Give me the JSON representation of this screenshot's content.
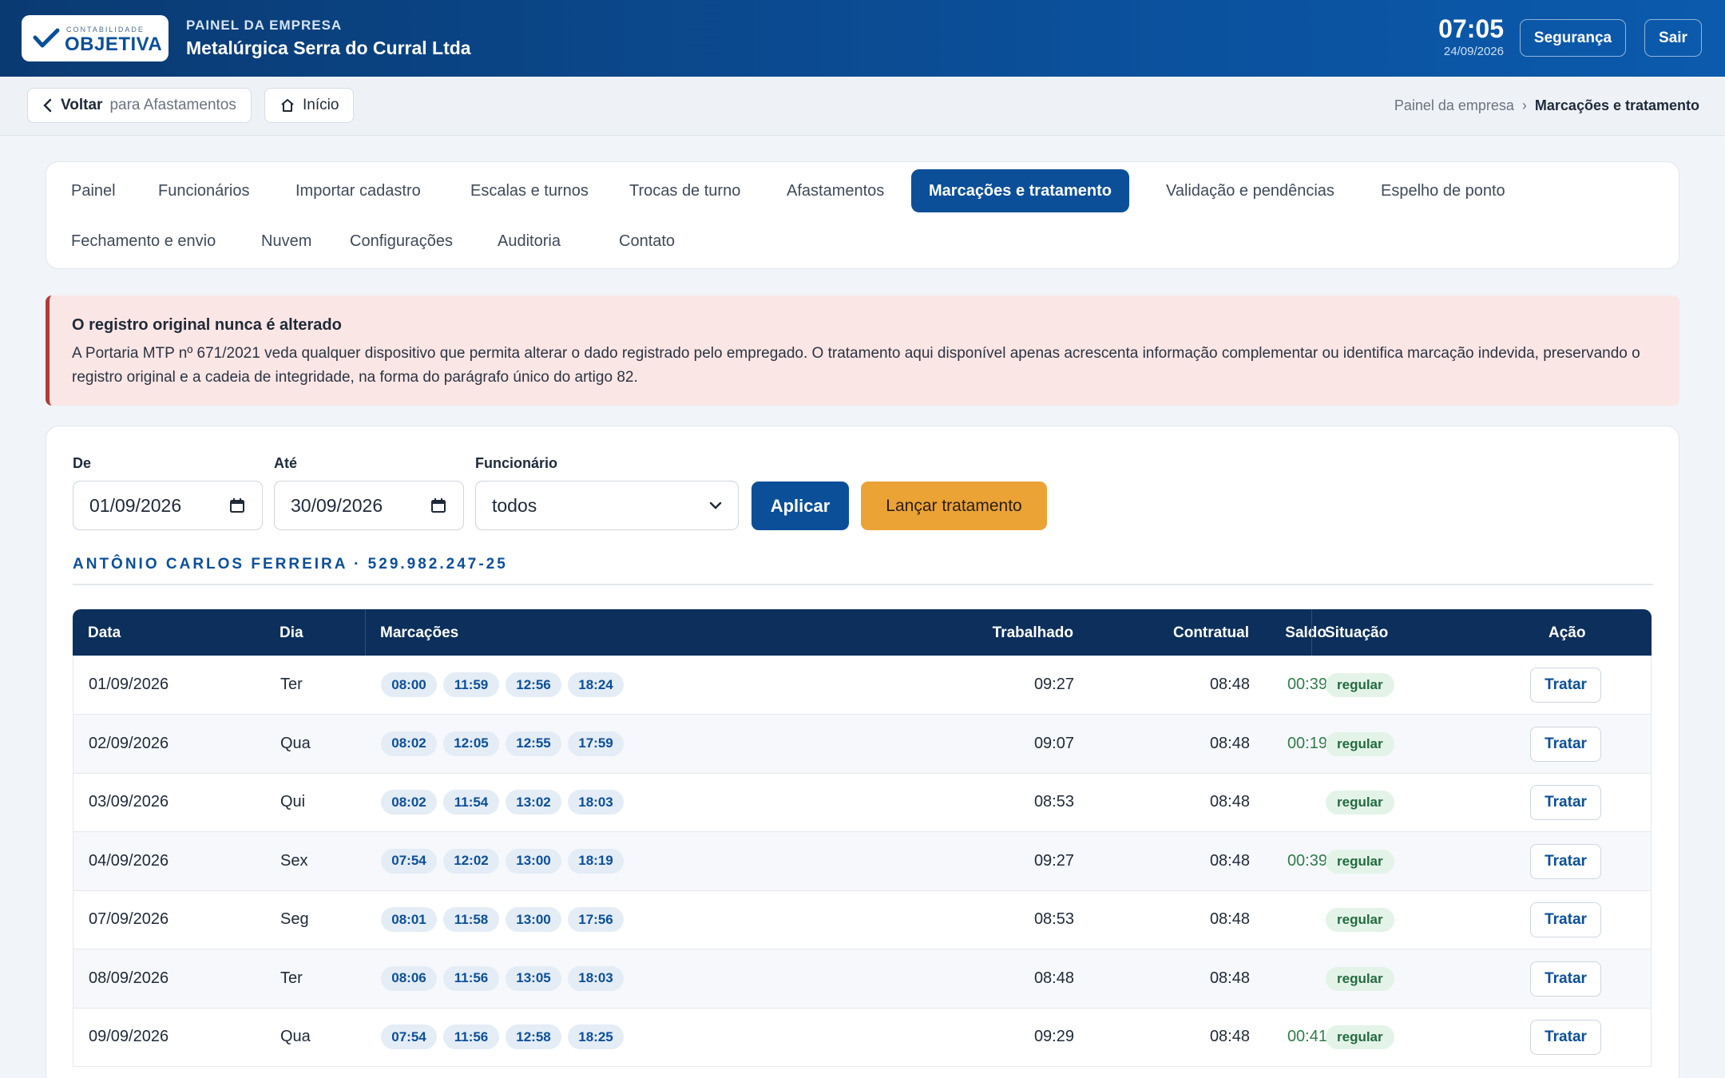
{
  "header": {
    "logo_small": "CONTABILIDADE",
    "logo_big": "OBJETIVA",
    "kicker": "PAINEL DA EMPRESA",
    "company": "Metalúrgica Serra do Curral Ltda",
    "time": "07:05",
    "date": "24/09/2026",
    "security_label": "Segurança",
    "logout_label": "Sair"
  },
  "subbar": {
    "back_label": "Voltar",
    "back_target": "para Afastamentos",
    "home_label": "Início",
    "breadcrumb": [
      "Painel da empresa",
      "Marcações e tratamento"
    ],
    "breadcrumb_sep": "›"
  },
  "nav": {
    "tabs": [
      "Painel",
      "Funcionários",
      "Importar cadastro",
      "Escalas e turnos",
      "Trocas de turno",
      "Afastamentos",
      "Marcações e tratamento",
      "Validação e pendências",
      "Espelho de ponto",
      "Fechamento e envio",
      "Nuvem",
      "Configurações",
      "Auditoria",
      "Contato"
    ],
    "active": "Marcações e tratamento"
  },
  "alert": {
    "title": "O registro original nunca é alterado",
    "text": "A Portaria MTP nº 671/2021 veda qualquer dispositivo que permita alterar o dado registrado pelo empregado. O tratamento aqui disponível apenas acrescenta informação complementar ou identifica marcação indevida, preservando o registro original e a cadeia de integridade, na forma do parágrafo único do artigo 82."
  },
  "filters": {
    "from_label": "De",
    "from_value": "01/09/2026",
    "to_label": "Até",
    "to_value": "30/09/2026",
    "employee_label": "Funcionário",
    "employee_value": "todos",
    "apply_label": "Aplicar",
    "launch_label": "Lançar tratamento"
  },
  "employee_heading": "ANTÔNIO CARLOS FERREIRA · 529.982.247-25",
  "table": {
    "headers": {
      "data": "Data",
      "dia": "Dia",
      "marcacoes": "Marcações",
      "trabalhado": "Trabalhado",
      "contratual": "Contratual",
      "saldo": "Saldo",
      "situacao": "Situação",
      "acao": "Ação"
    },
    "action_label": "Tratar",
    "rows": [
      {
        "data": "01/09/2026",
        "dia": "Ter",
        "marcacoes": [
          "08:00",
          "11:59",
          "12:56",
          "18:24"
        ],
        "trabalhado": "09:27",
        "contratual": "08:48",
        "saldo": "00:39",
        "situacao": "regular"
      },
      {
        "data": "02/09/2026",
        "dia": "Qua",
        "marcacoes": [
          "08:02",
          "12:05",
          "12:55",
          "17:59"
        ],
        "trabalhado": "09:07",
        "contratual": "08:48",
        "saldo": "00:19",
        "situacao": "regular"
      },
      {
        "data": "03/09/2026",
        "dia": "Qui",
        "marcacoes": [
          "08:02",
          "11:54",
          "13:02",
          "18:03"
        ],
        "trabalhado": "08:53",
        "contratual": "08:48",
        "saldo": "",
        "situacao": "regular"
      },
      {
        "data": "04/09/2026",
        "dia": "Sex",
        "marcacoes": [
          "07:54",
          "12:02",
          "13:00",
          "18:19"
        ],
        "trabalhado": "09:27",
        "contratual": "08:48",
        "saldo": "00:39",
        "situacao": "regular"
      },
      {
        "data": "07/09/2026",
        "dia": "Seg",
        "marcacoes": [
          "08:01",
          "11:58",
          "13:00",
          "17:56"
        ],
        "trabalhado": "08:53",
        "contratual": "08:48",
        "saldo": "",
        "situacao": "regular"
      },
      {
        "data": "08/09/2026",
        "dia": "Ter",
        "marcacoes": [
          "08:06",
          "11:56",
          "13:05",
          "18:03"
        ],
        "trabalhado": "08:48",
        "contratual": "08:48",
        "saldo": "",
        "situacao": "regular"
      },
      {
        "data": "09/09/2026",
        "dia": "Qua",
        "marcacoes": [
          "07:54",
          "11:56",
          "12:58",
          "18:25"
        ],
        "trabalhado": "09:29",
        "contratual": "08:48",
        "saldo": "00:41",
        "situacao": "regular"
      }
    ]
  },
  "colors": {
    "primary": "#0b4f99",
    "table_header": "#0c2f5c",
    "accent_orange": "#eba336",
    "alert_bg": "#fbe6e6",
    "alert_border": "#b33a3a",
    "positive": "#2f7d4a"
  }
}
